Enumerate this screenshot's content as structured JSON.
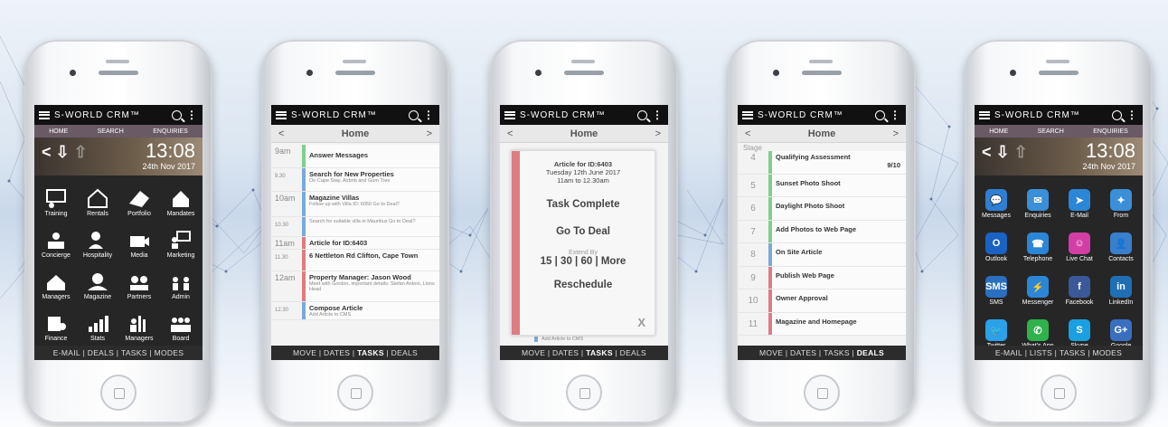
{
  "brand": "S-WORLD CRM™",
  "phone1": {
    "subnav": [
      "HOME",
      "SEARCH",
      "ENQUIRIES"
    ],
    "nav_arrow": "<",
    "time": "13:08",
    "date": "24th Nov 2017",
    "tiles": [
      "Training",
      "Rentals",
      "Portfolio",
      "Mandates",
      "Concierge",
      "Hospitality",
      "Media",
      "Marketing",
      "Managers",
      "Magazine",
      "Partners",
      "Admin",
      "Finance",
      "Stats",
      "Managers",
      "Board"
    ],
    "bottom": [
      "E-MAIL",
      "DEALS",
      "TASKS",
      "MODES"
    ]
  },
  "phone2": {
    "header": {
      "prev": "<",
      "title": "Home",
      "next": ">"
    },
    "rows": [
      {
        "time": "9am",
        "title": "Answer Messages",
        "detail": "",
        "color": "#7fd08a"
      },
      {
        "time": "9.30",
        "title": "Search for New Properties",
        "detail": "On Cape Stay, Airbnb and Gum Tree",
        "color": "#7aaad6"
      },
      {
        "time": "10am",
        "title": "Magazine Villas",
        "detail": "Follow up with Villa ID: 6050 Go to Deal?",
        "color": "#7aaad6"
      },
      {
        "time": "10.30",
        "title": "",
        "detail": "Search for suitable villa in Mauritius Go to Deal?",
        "color": "#7aaad6"
      },
      {
        "time": "11am",
        "title": "Article for ID:6403",
        "detail": "",
        "color": "#dd7c82"
      },
      {
        "time": "11.30",
        "title": "6 Nettleton Rd Clifton, Cape Town",
        "detail": "",
        "color": "#dd7c82"
      },
      {
        "time": "12am",
        "title": "Property Manager: Jason Wood",
        "detail": "Meet with Gordon, important details: Stefan Antoni, Lions Head",
        "color": "#dd7c82"
      },
      {
        "time": "12.30",
        "title": "Compose Article",
        "detail": "Add Article to CMS",
        "color": "#7aaad6"
      }
    ],
    "bottom": [
      "MOVE",
      "DATES",
      "TASKS",
      "DEALS"
    ]
  },
  "phone3": {
    "header": {
      "prev": "<",
      "title": "Home",
      "next": ">"
    },
    "article": "Article for ID:6403",
    "date": "Tuesday 12th June 2017",
    "time": "11am to 12.30am",
    "task_complete": "Task Complete",
    "go_to_deal": "Go To Deal",
    "extend_by": "Extend By",
    "extend_options": "15 | 30 | 60 | More",
    "reschedule": "Reschedule",
    "close": "X",
    "peek": "Add Article to CMS",
    "bottom": [
      "MOVE",
      "DATES",
      "TASKS",
      "DEALS"
    ]
  },
  "phone4": {
    "header": {
      "prev": "<",
      "title": "Home",
      "next": ">"
    },
    "stage_label": "Stage",
    "stages": [
      {
        "n": "4",
        "title": "Qualifying Assessment",
        "score": "9/10",
        "color": "#7fd08a"
      },
      {
        "n": "5",
        "title": "Sunset Photo Shoot",
        "score": "",
        "color": "#7fd08a"
      },
      {
        "n": "6",
        "title": "Daylight Photo Shoot",
        "score": "",
        "color": "#7fd08a"
      },
      {
        "n": "7",
        "title": "Add Photos to Web Page",
        "score": "",
        "color": "#7fd08a"
      },
      {
        "n": "8",
        "title": "On Site Article",
        "score": "",
        "color": "#7aaad6"
      },
      {
        "n": "9",
        "title": "Publish Web Page",
        "score": "",
        "color": "#dd7c82"
      },
      {
        "n": "10",
        "title": "Owner Approval",
        "score": "",
        "color": "#dd7c82"
      },
      {
        "n": "11",
        "title": "Magazine and Homepage",
        "score": "",
        "color": "#dd7c82"
      }
    ],
    "bottom": [
      "MOVE",
      "DATES",
      "TASKS",
      "DEALS"
    ]
  },
  "phone5": {
    "subnav": [
      "HOME",
      "SEARCH",
      "ENQUIRIES"
    ],
    "nav_arrow": "<",
    "time": "13:08",
    "date": "24th Nov 2017",
    "tiles": [
      {
        "label": "Messages",
        "color": "#2f7fd3",
        "glyph": "💬"
      },
      {
        "label": "Enquiries",
        "color": "#3a8fd8",
        "glyph": "✉"
      },
      {
        "label": "E-Mail",
        "color": "#2b86d6",
        "glyph": "➤"
      },
      {
        "label": "From",
        "color": "#3a8fd8",
        "glyph": "✦"
      },
      {
        "label": "Outlook",
        "color": "#1a63c2",
        "glyph": "O"
      },
      {
        "label": "Telephone",
        "color": "#2b86d6",
        "glyph": "☎"
      },
      {
        "label": "Live Chat",
        "color": "#d23ea6",
        "glyph": "☺"
      },
      {
        "label": "Contacts",
        "color": "#3a7fce",
        "glyph": "👤"
      },
      {
        "label": "SMS",
        "color": "#2a6fc0",
        "glyph": "SMS"
      },
      {
        "label": "Messenger",
        "color": "#2b86d6",
        "glyph": "⚡"
      },
      {
        "label": "Facebook",
        "color": "#3b5998",
        "glyph": "f"
      },
      {
        "label": "LinkedIn",
        "color": "#1f6fb5",
        "glyph": "in"
      },
      {
        "label": "Twitter",
        "color": "#2aa1e8",
        "glyph": "🐦"
      },
      {
        "label": "What's App",
        "color": "#2fb24c",
        "glyph": "✆"
      },
      {
        "label": "Skype",
        "color": "#1aa0e0",
        "glyph": "S"
      },
      {
        "label": "Google",
        "color": "#3a6fc0",
        "glyph": "G+"
      }
    ],
    "bottom": [
      "E-MAIL",
      "LISTS",
      "TASKS",
      "MODES"
    ]
  }
}
